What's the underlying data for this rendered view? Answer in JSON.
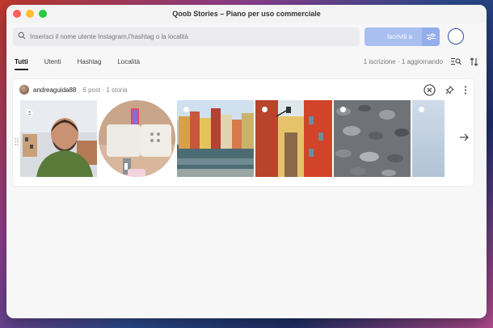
{
  "window": {
    "title": "Qoob Stories – Piano per uso commerciale"
  },
  "search": {
    "placeholder": "Inserisci il nome utente Instagram,l'hashtag o la località"
  },
  "subscribe": {
    "label": "Iscriviti a"
  },
  "tabs": [
    {
      "label": "Tutti",
      "active": true
    },
    {
      "label": "Utenti"
    },
    {
      "label": "Hashtag"
    },
    {
      "label": "Località"
    }
  ],
  "summary": {
    "subscriptions": "1 iscrizione",
    "separator": "·",
    "updating": "1 aggiornando"
  },
  "profile": {
    "username": "andreaguida88",
    "posts": "6 post",
    "dot": "·",
    "stories": "1 storia"
  },
  "thumbnails": [
    {
      "name": "selfie",
      "kind": "video"
    },
    {
      "name": "speaker-gift",
      "kind": "story"
    },
    {
      "name": "harbor-houses",
      "kind": "photo"
    },
    {
      "name": "street-lamp",
      "kind": "photo"
    },
    {
      "name": "pebbles",
      "kind": "photo"
    },
    {
      "name": "sky",
      "kind": "photo"
    }
  ],
  "colors": {
    "accent": "#a9bff0",
    "accentDark": "#2c4a9e",
    "close": "#ff5f57",
    "minimize": "#febc2e",
    "zoom": "#28c840"
  }
}
